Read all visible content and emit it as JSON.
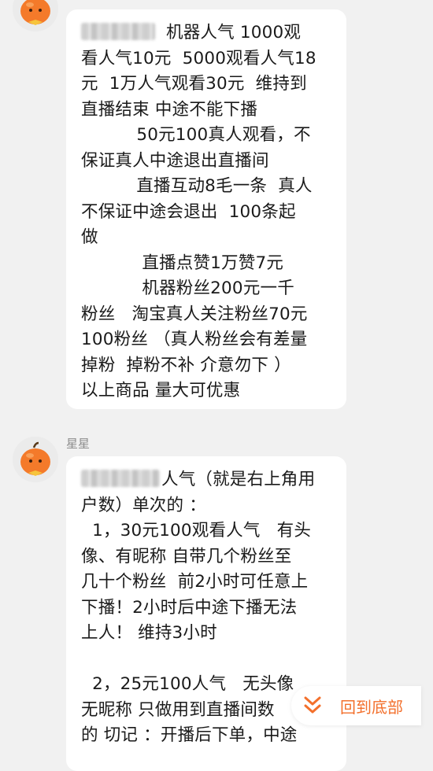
{
  "messages": [
    {
      "sender": "",
      "lines": [
        "机器人气 1000观",
        "看人气10元  5000观看人气18",
        "元  1万人气观看30元  维持到",
        "直播结束 中途不能下播",
        "          50元100真人观看，不",
        "保证真人中途退出直播间",
        "          直播互动8毛一条  真人",
        "不保证中途会退出  100条起",
        "做",
        "           直播点赞1万赞7元",
        "           机器粉丝200元一千",
        "粉丝   淘宝真人关注粉丝70元",
        "100粉丝 （真人粉丝会有差量",
        "掉粉  掉粉不补 介意勿下 ）",
        "以上商品 量大可优惠"
      ]
    },
    {
      "sender": "星星",
      "lines": [
        "人气（就是右上角用",
        "户数）单次的 ：",
        "  1，30元100观看人气   有头",
        "像、有昵称 自带几个粉丝至",
        "几十个粉丝  前2小时可任意上",
        "下播！2小时后中途下播无法",
        "上人！ 维持3小时",
        "",
        "  2，25元100人气   无头像",
        "无昵称 只做用到直播间数",
        "的 切记 ：开播后下单，中途"
      ]
    }
  ],
  "scroll_to_bottom": {
    "label": "回到底部",
    "icon": "double-chevron-down-icon"
  },
  "colors": {
    "background": "#f1f1f1",
    "bubble": "#ffffff",
    "accent": "#f3702c"
  }
}
